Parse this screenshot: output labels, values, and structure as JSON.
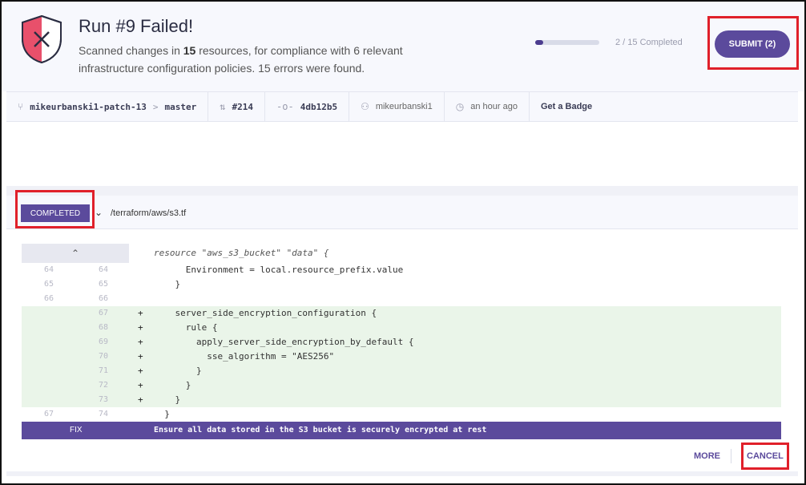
{
  "header": {
    "title": "Run #9 Failed!",
    "desc_prefix": "Scanned changes in ",
    "resources_count": "15",
    "desc_suffix": " resources, for compliance with 6 relevant infrastructure configuration policies. 15 errors were found.",
    "progress_fraction": 0.13,
    "progress_text": "2 / 15 Completed",
    "submit_label": "SUBMIT (2)",
    "shield_icon": "shield-x-icon",
    "colors": {
      "accent": "#5b4a9c",
      "danger": "#e8506b",
      "highlight": "#e0202a"
    }
  },
  "meta": {
    "branch": "mikeurbanski1-patch-13",
    "branch_sep": ">",
    "base": "master",
    "pr": "#214",
    "commit": "4db12b5",
    "user": "mikeurbanski1",
    "time": "an hour ago",
    "badge_link": "Get a Badge"
  },
  "file": {
    "status": "COMPLETED",
    "path": "/terraform/aws/s3.tf"
  },
  "diff": {
    "resource_line": "resource \"aws_s3_bucket\" \"data\" {",
    "context_before": [
      {
        "old": "64",
        "new": "64",
        "code": "      Environment = local.resource_prefix.value"
      },
      {
        "old": "65",
        "new": "65",
        "code": "    }"
      },
      {
        "old": "66",
        "new": "66",
        "code": ""
      }
    ],
    "added": [
      {
        "new": "67",
        "code": "    server_side_encryption_configuration {"
      },
      {
        "new": "68",
        "code": "      rule {"
      },
      {
        "new": "69",
        "code": "        apply_server_side_encryption_by_default {"
      },
      {
        "new": "70",
        "code": "          sse_algorithm = \"AES256\""
      },
      {
        "new": "71",
        "code": "        }"
      },
      {
        "new": "72",
        "code": "      }"
      },
      {
        "new": "73",
        "code": "    }"
      }
    ],
    "context_after": [
      {
        "old": "67",
        "new": "74",
        "code": "  }"
      }
    ]
  },
  "fix": {
    "label": "FIX",
    "text": "Ensure all data stored in the S3 bucket is securely encrypted at rest"
  },
  "actions": {
    "more": "MORE",
    "cancel": "CANCEL"
  }
}
